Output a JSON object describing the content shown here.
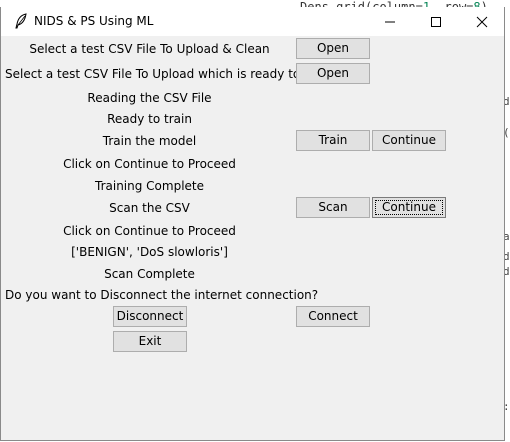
{
  "window": {
    "title": "NIDS & PS Using ML"
  },
  "background": {
    "code_prefix": "Dens.grid(column=",
    "code_col": "1",
    "code_mid": ", row=",
    "code_row": "8",
    "code_suffix": ")"
  },
  "rows": {
    "upload_clean_label": "Select a test CSV File To Upload & Clean",
    "upload_clean_button": "Open",
    "upload_ready_label": "Select a test CSV File To Upload which is ready to train",
    "upload_ready_button": "Open",
    "status_reading": "Reading the CSV File",
    "status_ready": "Ready to train",
    "train_label": "Train the model",
    "train_button": "Train",
    "train_continue_button": "Continue",
    "status_continue_1": "Click on Continue to Proceed",
    "status_training_complete": "Training Complete",
    "scan_label": "Scan the CSV",
    "scan_button": "Scan",
    "scan_continue_button": "Continue",
    "status_continue_2": "Click on Continue to Proceed",
    "scan_result": "['BENIGN', 'DoS slowloris']",
    "status_scan_complete": "Scan Complete",
    "disconnect_question": "Do you want to Disconnect the internet connection?",
    "disconnect_button": "Disconnect",
    "connect_button": "Connect",
    "exit_button": "Exit"
  }
}
